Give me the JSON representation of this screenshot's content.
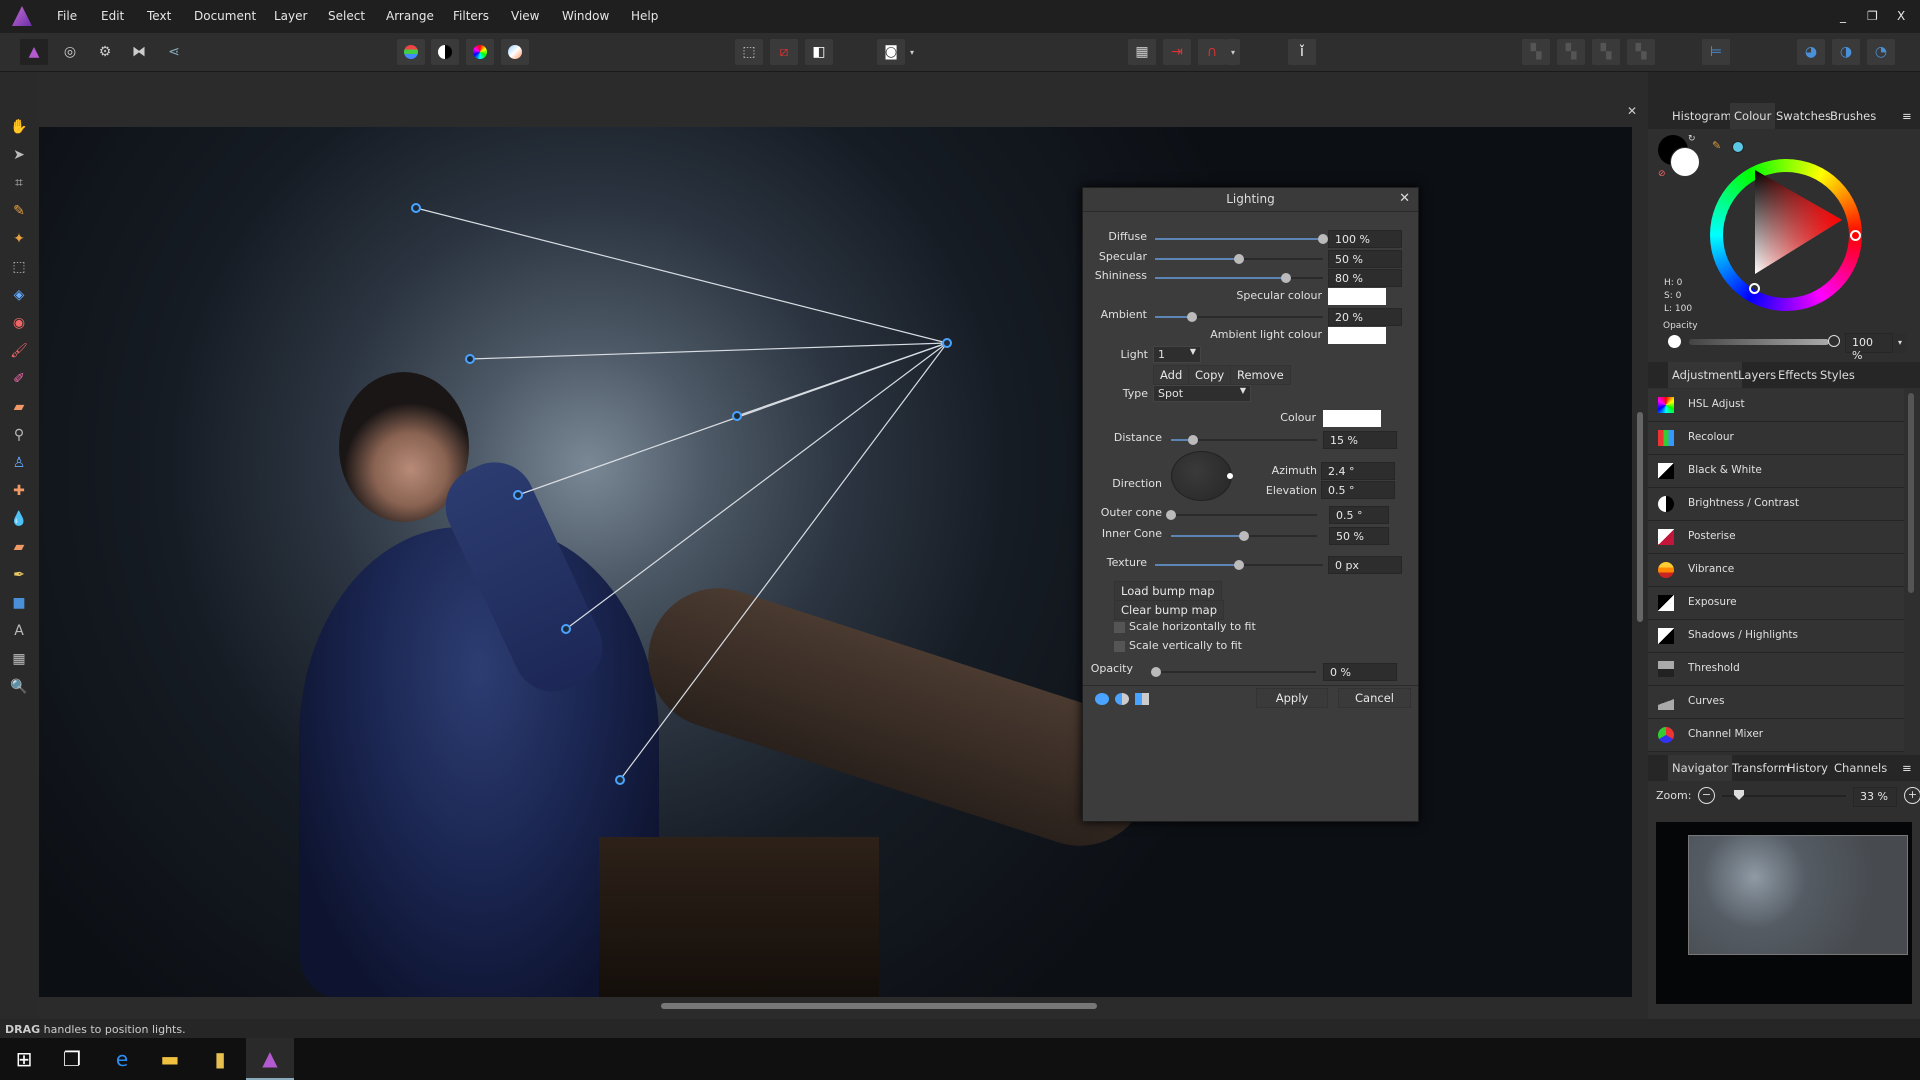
{
  "menu": [
    "File",
    "Edit",
    "Text",
    "Document",
    "Layer",
    "Select",
    "Arrange",
    "Filters",
    "View",
    "Window",
    "Help"
  ],
  "window_controls": {
    "minimize": "_",
    "restore": "❐",
    "close": "X"
  },
  "toolbar": {
    "personas": [
      "photo-persona",
      "liquify-persona",
      "develop-persona",
      "tone-mapping-persona",
      "export-persona"
    ],
    "adjust": [
      "auto-levels",
      "auto-contrast",
      "auto-colour",
      "auto-white-balance"
    ]
  },
  "status": {
    "bold": "DRAG",
    "text": "handles to position lights."
  },
  "right_panel": {
    "top_tabs": [
      "Histogram",
      "Colour",
      "Swatches",
      "Brushes"
    ],
    "active_top_tab": "Colour",
    "hsl": {
      "h": "H: 0",
      "s": "S: 0",
      "l": "L: 100"
    },
    "opacity_label": "Opacity",
    "opacity_value": "100 %",
    "mid_tabs": [
      "Adjustment",
      "Layers",
      "Effects",
      "Styles"
    ],
    "adjustments": [
      "HSL Adjust",
      "Recolour",
      "Black & White",
      "Brightness / Contrast",
      "Posterise",
      "Vibrance",
      "Exposure",
      "Shadows / Highlights",
      "Threshold",
      "Curves",
      "Channel Mixer"
    ],
    "bottom_tabs": [
      "Navigator",
      "Transform",
      "History",
      "Channels"
    ],
    "zoom_label": "Zoom:",
    "zoom_value": "33 %"
  },
  "dialog": {
    "title": "Lighting",
    "diffuse": {
      "label": "Diffuse",
      "value": "100 %",
      "fill": 1.0
    },
    "specular": {
      "label": "Specular",
      "value": "50 %",
      "fill": 0.5
    },
    "shininess": {
      "label": "Shininess",
      "value": "80 %",
      "fill": 0.78
    },
    "specular_colour": "Specular colour",
    "ambient": {
      "label": "Ambient",
      "value": "20 %",
      "fill": 0.22
    },
    "ambient_colour": "Ambient light colour",
    "light_label": "Light",
    "light_value": "1",
    "add": "Add",
    "copy": "Copy",
    "remove": "Remove",
    "type_label": "Type",
    "type_value": "Spot",
    "colour": "Colour",
    "distance": {
      "label": "Distance",
      "value": "15 %",
      "fill": 0.15
    },
    "direction": "Direction",
    "azimuth_label": "Azimuth",
    "azimuth": "2.4 °",
    "elevation_label": "Elevation",
    "elevation": "0.5 °",
    "outer_cone": {
      "label": "Outer cone",
      "value": "0.5 °",
      "fill": 0.0
    },
    "inner_cone": {
      "label": "Inner Cone",
      "value": "50 %",
      "fill": 0.5
    },
    "texture": {
      "label": "Texture",
      "value": "0 px",
      "fill": 0.5
    },
    "load_bump": "Load bump map",
    "clear_bump": "Clear bump map",
    "scale_h": "Scale horizontally to fit",
    "scale_v": "Scale vertically to fit",
    "opacity": {
      "label": "Opacity",
      "value": "0 %",
      "fill": 0.0
    },
    "apply": "Apply",
    "cancel": "Cancel"
  },
  "colors": {
    "accent": "#4aa3ff",
    "slider_fill": "#5c84b5",
    "secondary_colour": "#5bc8e6"
  }
}
